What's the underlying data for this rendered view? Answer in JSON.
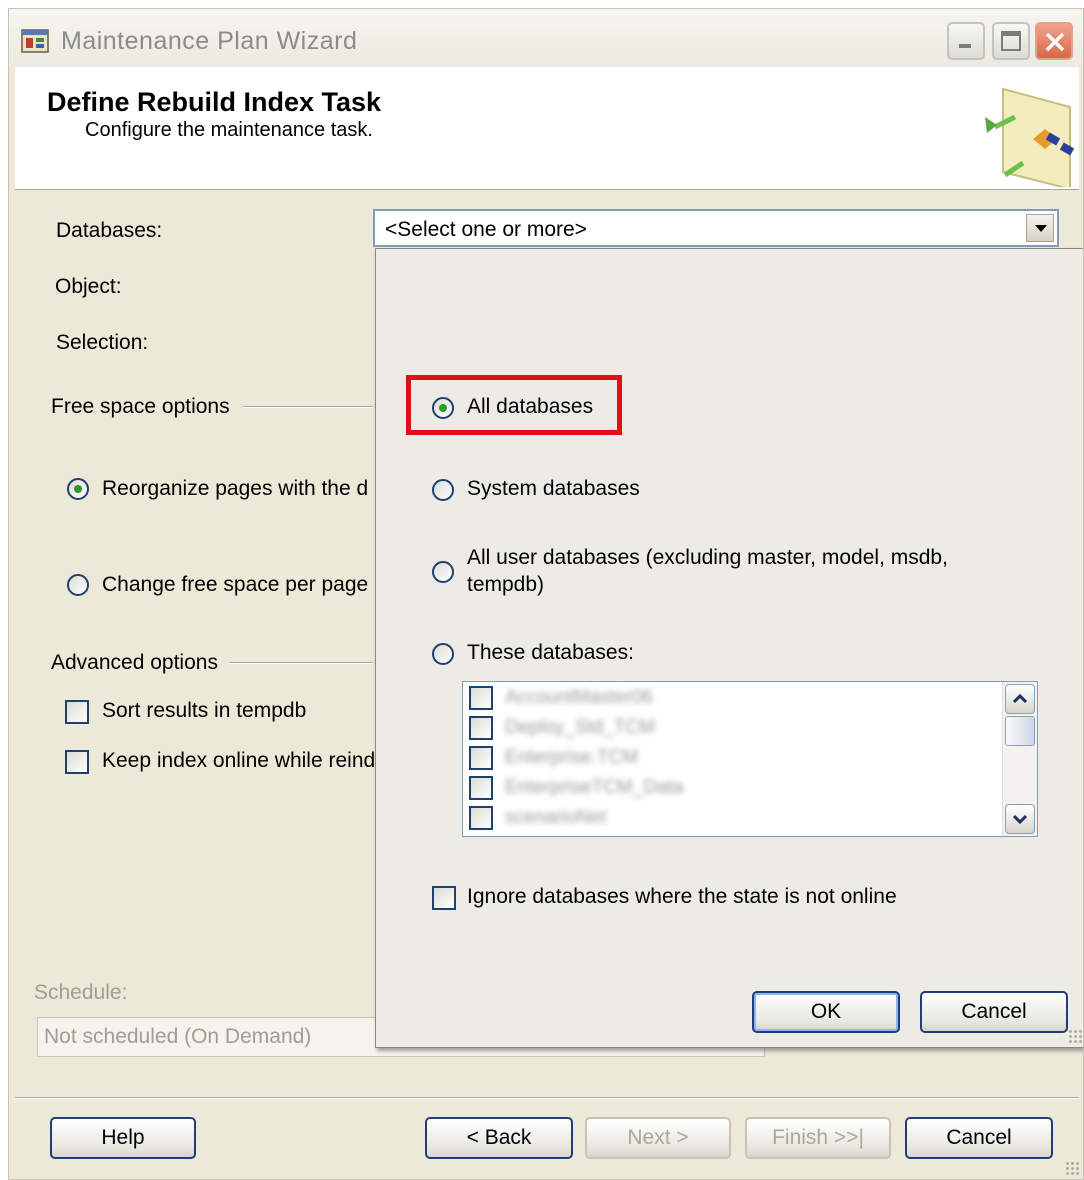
{
  "window": {
    "title": "Maintenance Plan Wizard"
  },
  "header": {
    "title": "Define Rebuild Index Task",
    "subtitle": "Configure the maintenance task."
  },
  "form": {
    "databases_label": "Databases:",
    "databases_value": "<Select one or more>",
    "object_label": "Object:",
    "selection_label": "Selection:",
    "free_space_group": "Free space options",
    "reorganize_option": "Reorganize pages with the d",
    "change_free_space_option": "Change free space per page",
    "advanced_group": "Advanced options",
    "sort_results_option": "Sort results in tempdb",
    "keep_online_option": "Keep index online while reind",
    "schedule_label": "Schedule:",
    "schedule_value": "Not scheduled (On Demand)"
  },
  "dropdown": {
    "all_databases": "All databases",
    "system_databases": "System databases",
    "all_user_databases_line1": "All user databases  (excluding master, model, msdb,",
    "all_user_databases_line2": "tempdb)",
    "these_databases": "These databases:",
    "database_list": [
      "AccountMaster06",
      "Deploy_Std_TCM",
      "Enterprise.TCM",
      "EnterpriseTCM_Data",
      "scenarioNet"
    ],
    "ignore_offline": "Ignore databases where the state is not online",
    "ok_label": "OK",
    "cancel_label": "Cancel",
    "selected_option": "all_databases"
  },
  "footer": {
    "help_label": "Help",
    "back_label": "< Back",
    "next_label": "Next >",
    "finish_label": "Finish >>|",
    "cancel_label": "Cancel"
  },
  "colors": {
    "highlight_box": "#e0101a",
    "window_bg": "#ece9d8",
    "button_border": "#1d3e7a"
  }
}
